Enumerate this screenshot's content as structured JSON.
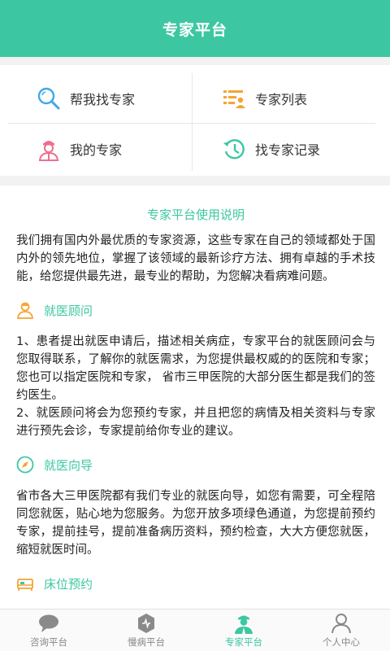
{
  "header": {
    "title": "专家平台"
  },
  "grid": {
    "items": [
      {
        "label": "帮我找专家",
        "icon": "search-icon"
      },
      {
        "label": "专家列表",
        "icon": "list-icon"
      },
      {
        "label": "我的专家",
        "icon": "doctor-icon"
      },
      {
        "label": "找专家记录",
        "icon": "history-icon"
      }
    ]
  },
  "intro": {
    "title": "专家平台使用说明",
    "text": "我们拥有国内外最优质的专家资源，这些专家在自己的领域都处于国内外的领先地位，掌握了该领域的最新诊疗方法、拥有卓越的手术技能，给您提供最先进，最专业的帮助，为您解决看病难问题。"
  },
  "sections": [
    {
      "title": "就医顾问",
      "icon": "counselor-icon",
      "text": "1、患者提出就医申请后，描述相关病症，专家平台的就医顾问会与您取得联系，了解你的就医需求，为您提供最权威的的医院和专家；您也可以指定医院和专家，   省市三甲医院的大部分医生都是我们的签约医生。\n2、就医顾问将会为您预约专家，并且把您的病情及相关资料与专家进行预先会诊，专家提前给你专业的建议。"
    },
    {
      "title": "就医向导",
      "icon": "compass-icon",
      "text": "省市各大三甲医院都有我们专业的就医向导，如您有需要，可全程陪同您就医，贴心地为您服务。为您开放多项绿色通道，为您提前预约专家，提前挂号，提前准备病历资料，预约检查，大大方便您就医，缩短就医时间。"
    },
    {
      "title": "床位预约",
      "icon": "bed-icon",
      "text": ""
    }
  ],
  "tabs": [
    {
      "label": "咨询平台",
      "icon": "chat-icon"
    },
    {
      "label": "慢病平台",
      "icon": "chronic-icon"
    },
    {
      "label": "专家平台",
      "icon": "expert-icon"
    },
    {
      "label": "个人中心",
      "icon": "person-icon"
    }
  ],
  "colors": {
    "accent": "#3cc7a2",
    "search": "#3fa9e8",
    "list": "#f4a532",
    "doctor": "#ee6f8c"
  }
}
